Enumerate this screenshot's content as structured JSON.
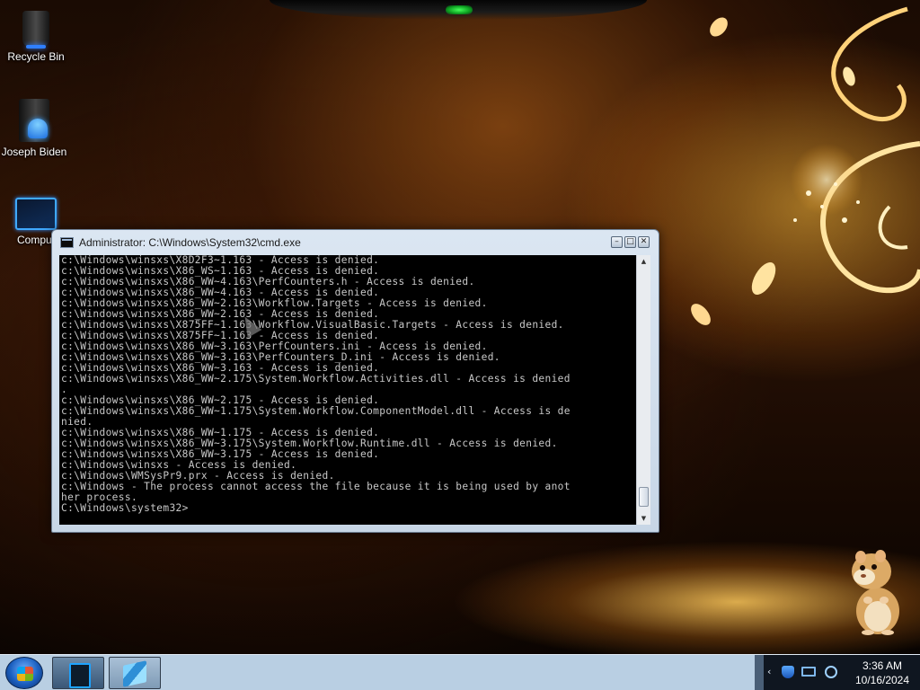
{
  "colors": {
    "console_background": "#000000",
    "console_text": "#c8c8c8",
    "taskbar": "#b9cfe3",
    "window_frame": "#c7d6e6"
  },
  "desktop": {
    "icons": [
      {
        "label": "Recycle Bin",
        "icon": "recycle-bin-icon"
      },
      {
        "label": "Joseph Biden",
        "icon": "user-folder-icon"
      },
      {
        "label": "Comput",
        "icon": "computer-icon"
      }
    ]
  },
  "window": {
    "title": "Administrator: C:\\Windows\\System32\\cmd.exe",
    "icon": "console-icon",
    "controls": {
      "minimize": "–",
      "maximize": "□",
      "close": "✕"
    },
    "console_lines": [
      "c:\\Windows\\winsxs\\X8D2F3~1.163 - Access is denied.",
      "c:\\Windows\\winsxs\\X86_WS~1.163 - Access is denied.",
      "c:\\Windows\\winsxs\\X86_WW~4.163\\PerfCounters.h - Access is denied.",
      "c:\\Windows\\winsxs\\X86_WW~4.163 - Access is denied.",
      "c:\\Windows\\winsxs\\X86_WW~2.163\\Workflow.Targets - Access is denied.",
      "c:\\Windows\\winsxs\\X86_WW~2.163 - Access is denied.",
      "c:\\Windows\\winsxs\\X875FF~1.163\\Workflow.VisualBasic.Targets - Access is denied.",
      "c:\\Windows\\winsxs\\X875FF~1.163 - Access is denied.",
      "c:\\Windows\\winsxs\\X86_WW~3.163\\PerfCounters.ini - Access is denied.",
      "c:\\Windows\\winsxs\\X86_WW~3.163\\PerfCounters_D.ini - Access is denied.",
      "c:\\Windows\\winsxs\\X86_WW~3.163 - Access is denied.",
      "c:\\Windows\\winsxs\\X86_WW~2.175\\System.Workflow.Activities.dll - Access is denied",
      ".",
      "c:\\Windows\\winsxs\\X86_WW~2.175 - Access is denied.",
      "c:\\Windows\\winsxs\\X86_WW~1.175\\System.Workflow.ComponentModel.dll - Access is de",
      "nied.",
      "c:\\Windows\\winsxs\\X86_WW~1.175 - Access is denied.",
      "c:\\Windows\\winsxs\\X86_WW~3.175\\System.Workflow.Runtime.dll - Access is denied.",
      "c:\\Windows\\winsxs\\X86_WW~3.175 - Access is denied.",
      "c:\\Windows\\winsxs - Access is denied.",
      "c:\\Windows\\WMSysPr9.prx - Access is denied.",
      "c:\\Windows - The process cannot access the file because it is being used by anot",
      "her process.",
      "",
      "C:\\Windows\\system32>"
    ],
    "scrollbar": {
      "up": "▲",
      "down": "▼"
    }
  },
  "taskbar": {
    "start_icon": "windows-start-icon",
    "apps": [
      {
        "name": "cmd-taskbar-button",
        "icon": "console-icon"
      },
      {
        "name": "regedit-taskbar-button",
        "icon": "registry-editor-icon"
      }
    ],
    "tray": {
      "chevron": "‹",
      "icons": [
        "security-shield-icon",
        "network-icon",
        "volume-icon"
      ],
      "time": "3:36 AM",
      "date": "10/16/2024"
    }
  }
}
